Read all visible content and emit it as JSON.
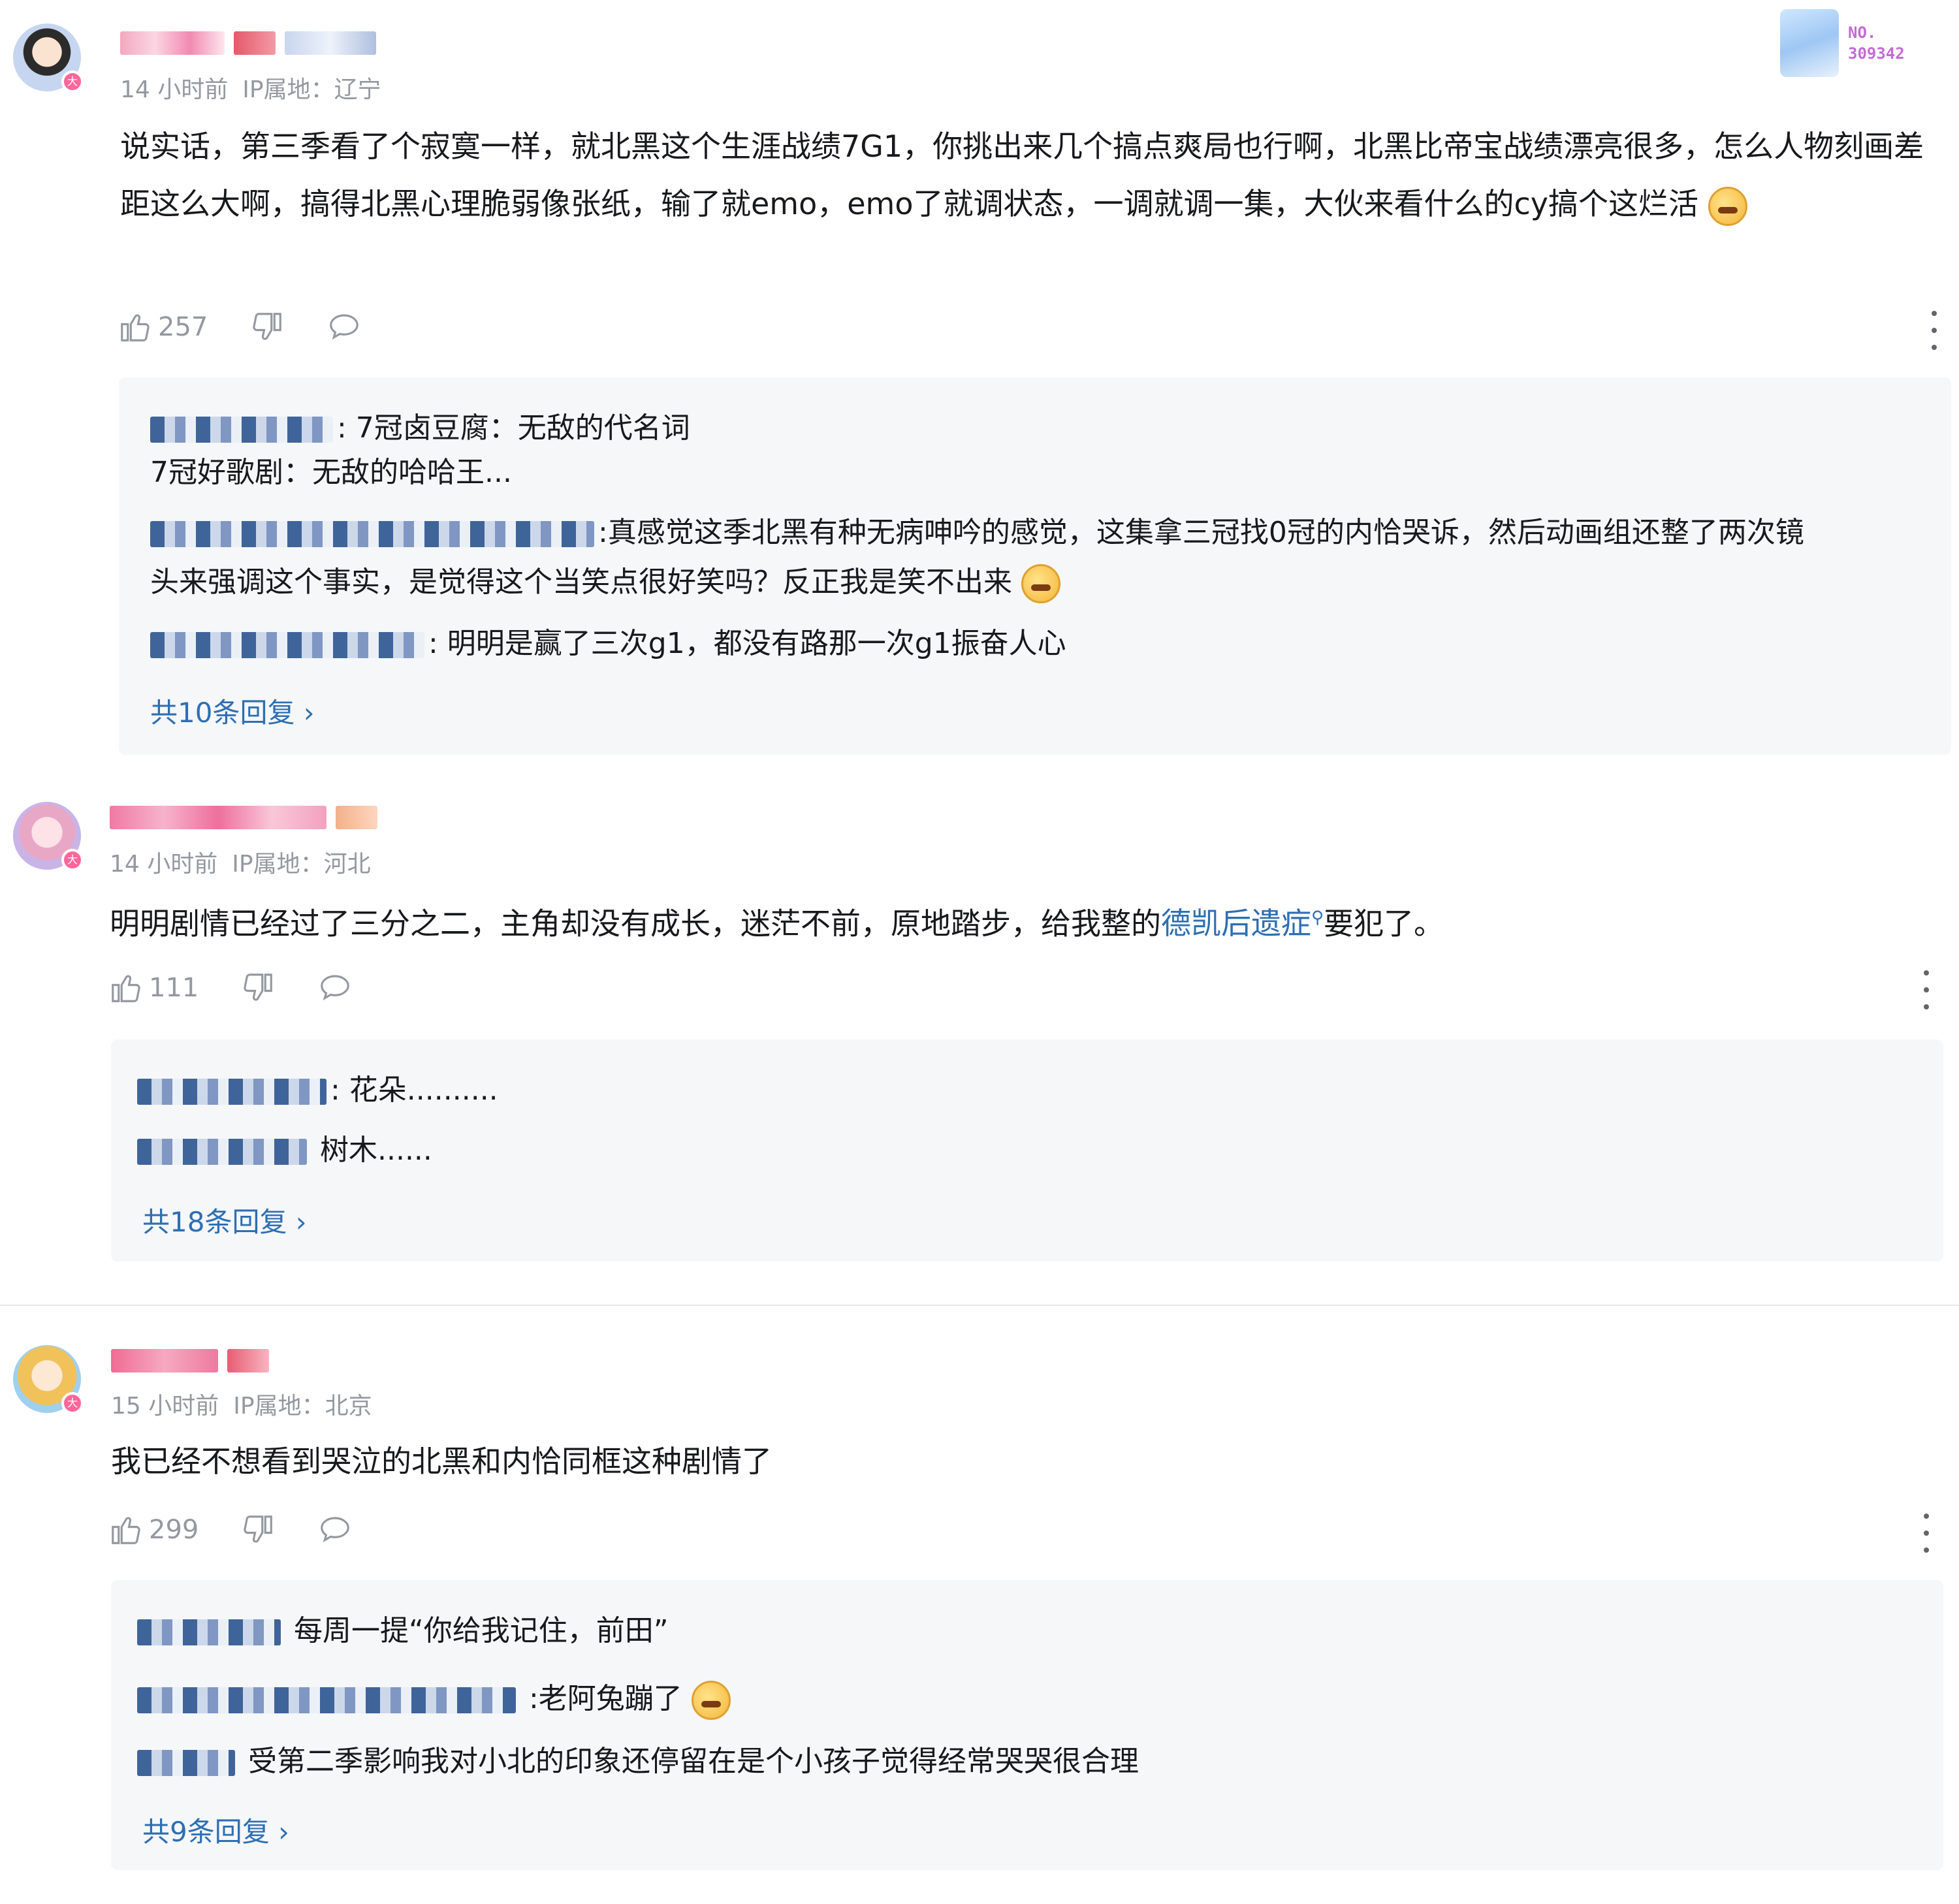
{
  "comments": [
    {
      "time": "14 小时前",
      "ip": "IP属地：辽宁",
      "content": "说实话，第三季看了个寂寞一样，就北黑这个生涯战绩7G1，你挑出来几个搞点爽局也行啊，北黑比帝宝战绩漂亮很多，怎么人物刻画差距这么大啊，搞得北黑心理脆弱像张纸，输了就emo，emo了就调状态，一调就调一集，大伙来看什么的cy搞个这烂活",
      "likes": "257",
      "deco_label": "NO.\n309342",
      "replies": [
        {
          "text": ": 7冠卤豆腐：无敌的代名词"
        },
        {
          "text": "7冠好歌剧：无敌的哈哈王..."
        },
        {
          "text": ":真感觉这季北黑有种无病呻吟的感觉，这集拿三冠找0冠的内恰哭诉，然后动画组还整了两次镜"
        },
        {
          "text": "头来强调这个事实，是觉得这个当笑点很好笑吗？反正我是笑不出来"
        },
        {
          "text": ": 明明是赢了三次g1，都没有路那一次g1振奋人心"
        }
      ],
      "more_replies": "共10条回复 ›"
    },
    {
      "time": "14 小时前",
      "ip": "IP属地：河北",
      "content_before": "明明剧情已经过了三分之二，主角却没有成长，迷茫不前，原地踏步，给我整的",
      "content_link": "德凯后遗症",
      "content_after": "要犯了。",
      "likes": "111",
      "replies": [
        {
          "text": ": 花朵.........."
        },
        {
          "text": " 树木......"
        }
      ],
      "more_replies": "共18条回复 ›"
    },
    {
      "time": "15 小时前",
      "ip": "IP属地：北京",
      "content": "我已经不想看到哭泣的北黑和内恰同框这种剧情了",
      "likes": "299",
      "replies": [
        {
          "text": " 每周一提“你给我记住，前田”"
        },
        {
          "text": " :老阿兔蹦了"
        },
        {
          "text": " 受第二季影响我对小北的印象还停留在是个小孩子觉得经常哭哭很合理"
        }
      ],
      "more_replies": "共9条回复 ›"
    }
  ],
  "icons": {
    "like": "thumbs-up-icon",
    "dislike": "thumbs-down-icon",
    "reply": "chat-bubble-icon",
    "more": "more-vertical-icon",
    "level_badge": "大"
  },
  "colors": {
    "link": "#2d6fb3",
    "meta": "#9499a0",
    "reply_bg": "#f6f7f8"
  }
}
